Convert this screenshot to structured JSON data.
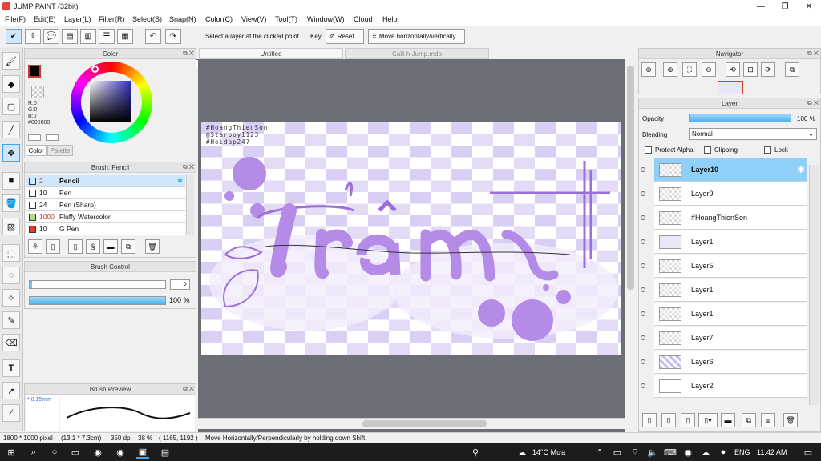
{
  "window": {
    "title": "JUMP PAINT (32bit)",
    "minimize": "—",
    "restore": "❐",
    "close": "✕"
  },
  "menu": [
    "File(F)",
    "Edit(E)",
    "Layer(L)",
    "Filter(R)",
    "Select(S)",
    "Snap(N)",
    "Color(C)",
    "View(V)",
    "Tool(T)",
    "Window(W)",
    "Cloud",
    "Help"
  ],
  "toolbar": {
    "select_layer_label": "Select a layer at the clicked point",
    "key_label": "Key",
    "reset_label": "Reset",
    "move_label": "Move horizontally/vertically"
  },
  "color_panel": {
    "title": "Color",
    "r": "R:0",
    "g": "G:0",
    "b": "B:0",
    "hex": "#000000",
    "tab_color": "Color",
    "tab_palette": "Palette",
    "accent": "#3fa7ef"
  },
  "brush_panel": {
    "title": "Brush: Pencil",
    "items": [
      {
        "size": "2",
        "name": "Pencil",
        "color": "#222222",
        "selected": true
      },
      {
        "size": "10",
        "name": "Pen",
        "color": "#222222"
      },
      {
        "size": "24",
        "name": "Pen (Sharp)",
        "color": "#222222"
      },
      {
        "size": "1000",
        "name": "Fluffy Watercolor",
        "color": "#a8e08a"
      },
      {
        "size": "10",
        "name": "G Pen",
        "color": "#e03a2e"
      }
    ]
  },
  "brush_control": {
    "title": "Brush Control",
    "size_value": "2",
    "opacity_value": "100 %",
    "size_fraction": 0.02,
    "opacity_fraction": 1.0
  },
  "brush_preview": {
    "title": "Brush Preview",
    "size_label": "* 0.15mm"
  },
  "tabs": [
    {
      "label": "Untitled"
    },
    {
      "label": "Calli h Jump.mdp"
    }
  ],
  "artwork": {
    "hashtags": [
      "#HoangThienSon",
      "@Starboy1123",
      "#Hoidap247"
    ],
    "word": "Trâm",
    "colors": {
      "purple": "#b48be6",
      "light": "#d9cef3",
      "deep": "#9b6fd9"
    }
  },
  "navigator": {
    "title": "Navigator"
  },
  "layer_panel": {
    "title": "Layer",
    "opacity_label": "Opacity",
    "opacity_value": "100 %",
    "opacity_fraction": 1.0,
    "blending_label": "Blending",
    "blending_value": "Normal",
    "protect_alpha": "Protect Alpha",
    "clipping": "Clipping",
    "lock": "Lock",
    "layers": [
      {
        "name": "Layer10",
        "selected": true
      },
      {
        "name": "Layer9"
      },
      {
        "name": "#HoangThienSon"
      },
      {
        "name": "Layer1"
      },
      {
        "name": "Layer5"
      },
      {
        "name": "Layer1"
      },
      {
        "name": "Layer1"
      },
      {
        "name": "Layer7"
      },
      {
        "name": "Layer6"
      },
      {
        "name": "Layer2"
      }
    ]
  },
  "status": {
    "size": "1800 * 1000 pixel",
    "cm": "(13.1 * 7.3cm)",
    "dpi": "350 dpi",
    "zoom": "38 %",
    "coords": "( 1165, 1192 )",
    "hint": "Move Horizontally/Perpendicularly by holding down Shift"
  },
  "taskbar": {
    "weather": "14°C Mưa",
    "lang": "ENG",
    "time": "11:42 AM"
  }
}
